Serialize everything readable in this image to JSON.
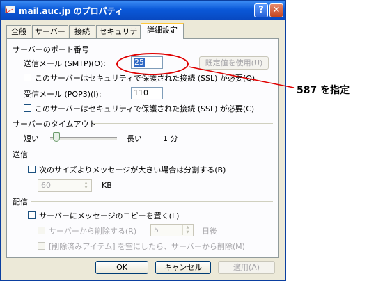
{
  "window": {
    "title": "mail.auc.jp のプロパティ",
    "help_glyph": "?",
    "close_glyph": "✕"
  },
  "tabs": [
    "全般",
    "サーバー",
    "接続",
    "セキュリティ",
    "詳細設定"
  ],
  "server_ports": {
    "heading": "サーバーのポート番号",
    "smtp_label": "送信メール (SMTP)(O):",
    "smtp_value": "25",
    "default_button": "既定値を使用(U)",
    "smtp_ssl_label": "このサーバーはセキュリティで保護された接続 (SSL) が必要(Q)",
    "smtp_ssl_checked": false,
    "pop3_label": "受信メール (POP3)(I):",
    "pop3_value": "110",
    "pop3_ssl_label": "このサーバーはセキュリティで保護された接続 (SSL) が必要(C)",
    "pop3_ssl_checked": false
  },
  "timeout": {
    "heading": "サーバーのタイムアウト",
    "short_label": "短い",
    "long_label": "長い",
    "value_text": "1 分",
    "level_fraction": 0.05
  },
  "send": {
    "heading": "送信",
    "split_label": "次のサイズよりメッセージが大きい場合は分割する(B)",
    "split_checked": false,
    "size_value": "60",
    "size_unit": "KB"
  },
  "delivery": {
    "heading": "配信",
    "keep_copy_label": "サーバーにメッセージのコピーを置く(L)",
    "keep_copy_checked": false,
    "remove_after_label": "サーバーから削除する(R)",
    "days_value": "5",
    "days_unit": "日後",
    "remove_on_empty_label": "[削除済みアイテム] を空にしたら、サーバーから削除(M)"
  },
  "footer": {
    "ok": "OK",
    "cancel": "キャンセル",
    "apply": "適用(A)"
  },
  "annotation": {
    "text": "587 を指定",
    "color": "#e00000"
  }
}
